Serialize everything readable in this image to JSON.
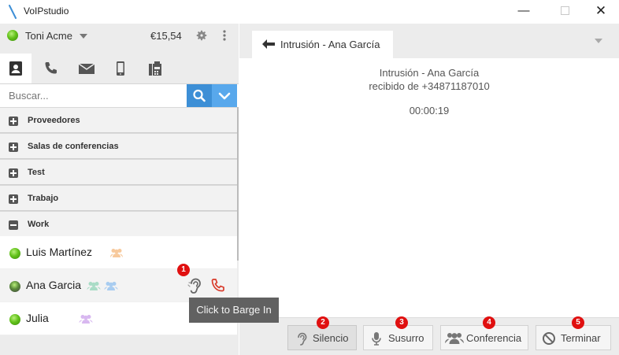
{
  "window": {
    "title": "VoIPstudio",
    "minimize": "—",
    "close": "✕"
  },
  "account": {
    "name": "Toni Acme",
    "balance": "€15,54"
  },
  "tabs": [
    "contacts",
    "calls",
    "messages",
    "mobile",
    "fax"
  ],
  "search": {
    "placeholder": "Buscar...",
    "value": ""
  },
  "groups": [
    {
      "label": "Proveedores",
      "expanded": false
    },
    {
      "label": "Salas de conferencias",
      "expanded": false
    },
    {
      "label": "Test",
      "expanded": false
    },
    {
      "label": "Trabajo",
      "expanded": false
    },
    {
      "label": "Work",
      "expanded": true
    }
  ],
  "contacts": [
    {
      "name": "Luis Martínez",
      "people_color": "#f7c99c"
    },
    {
      "name": "Ana Garcia",
      "people_colors": [
        "#a9dcc6",
        "#a8ccf0"
      ]
    },
    {
      "name": "Julia",
      "people_color": "#d8b8f0"
    }
  ],
  "tooltip": "Click to Barge In",
  "badges": [
    "1",
    "2",
    "3",
    "4",
    "5"
  ],
  "call": {
    "tab_label": "Intrusión - Ana García",
    "title": "Intrusión - Ana García",
    "subtitle": "recibido de +34871187010",
    "timer": "00:00:19"
  },
  "actions": {
    "silence": "Silencio",
    "whisper": "Susurro",
    "conference": "Conferencia",
    "hangup": "Terminar"
  },
  "colors": {
    "accent_blue": "#3d8fd6",
    "status_green": "#63c21b",
    "badge_red": "#e01010",
    "hangup_red": "#d83a2a"
  }
}
